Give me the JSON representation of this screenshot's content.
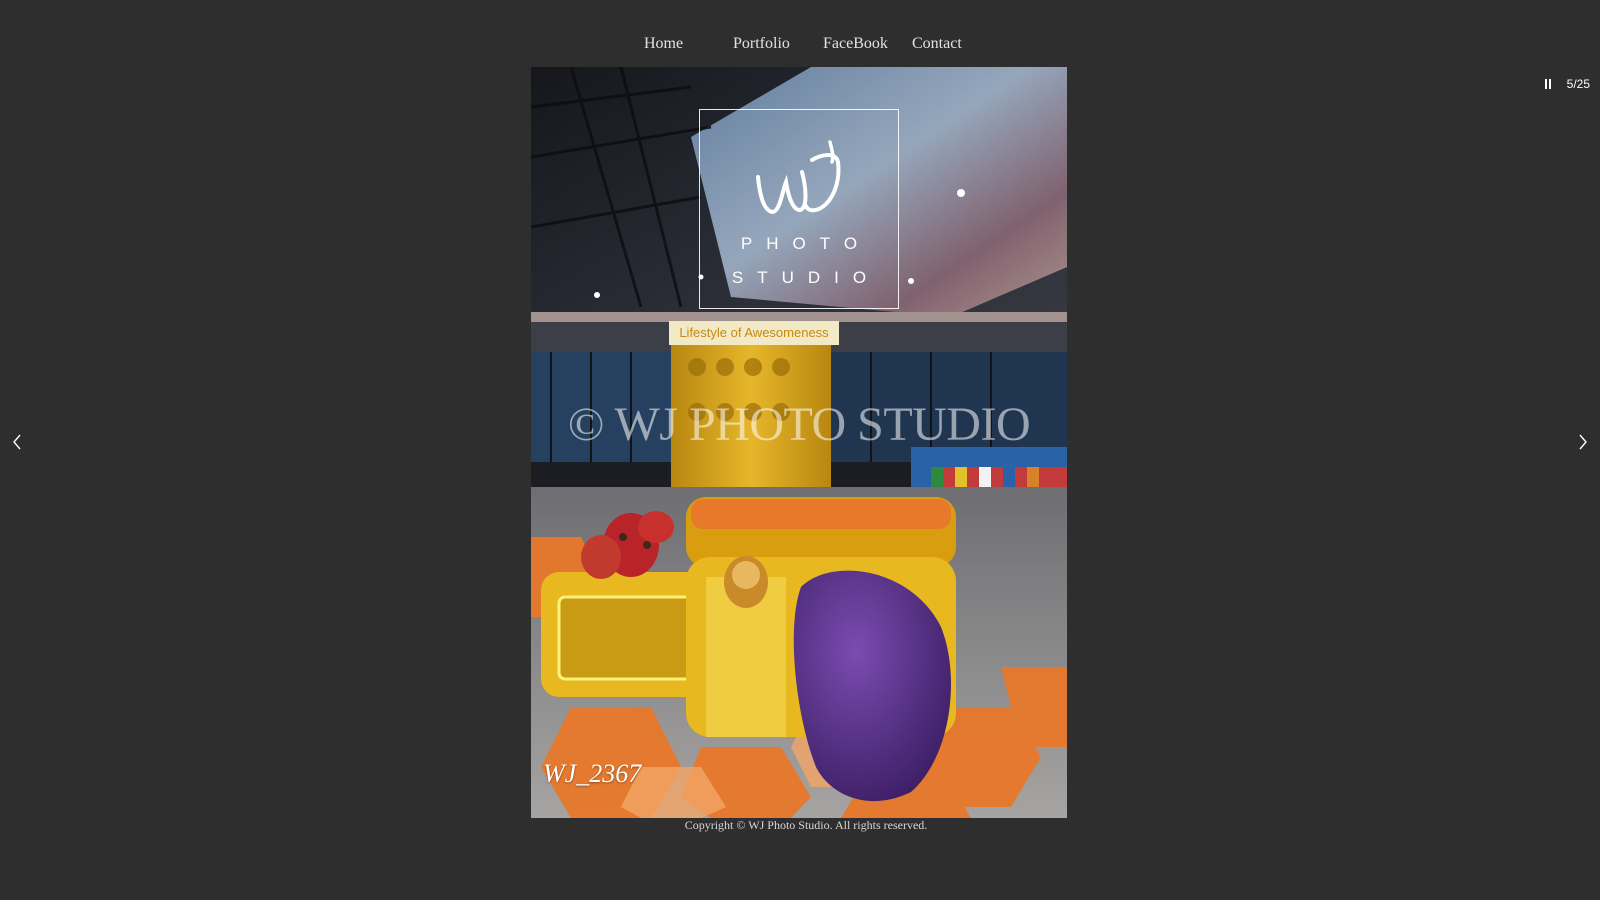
{
  "nav": {
    "items": [
      {
        "label": "Home"
      },
      {
        "label": "Portfolio"
      },
      {
        "label": "FaceBook"
      },
      {
        "label": "Contact"
      }
    ]
  },
  "slideshow": {
    "counter": "5/25",
    "pause_icon": "pause-icon",
    "prev_icon": "chevron-left-icon",
    "next_icon": "chevron-right-icon"
  },
  "photo": {
    "logo": {
      "line1": "PHOTO",
      "line2": "STUDIO"
    },
    "sign_text": "Lifestyle of Awesomeness",
    "watermark": "© WJ PHOTO STUDIO",
    "caption": "WJ_2367"
  },
  "footer": {
    "copyright": "Copyright © WJ Photo Studio. All rights reserved."
  },
  "colors": {
    "background": "#2e2e2e",
    "accent_yellow": "#e8b820",
    "accent_orange": "#e8782a",
    "accent_purple": "#5a2f8a"
  }
}
